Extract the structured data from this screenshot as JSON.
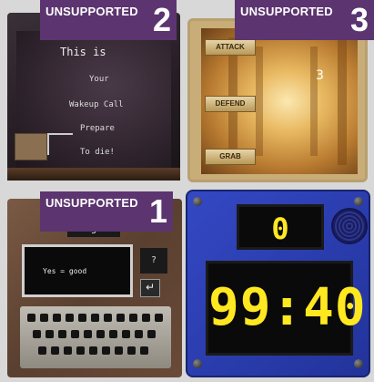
{
  "panels": [
    {
      "tag": "UNSUPPORTED",
      "number": "2"
    },
    {
      "tag": "UNSUPPORTED",
      "number": "3"
    },
    {
      "tag": "UNSUPPORTED",
      "number": "1"
    }
  ],
  "puzzle2": {
    "lines": [
      "This is",
      "Your",
      "Wakeup Call",
      "Prepare",
      "To die!"
    ]
  },
  "puzzle3": {
    "buttons": [
      "ATTACK",
      "DEFEND",
      "GRAB"
    ],
    "value": "3"
  },
  "puzzle1": {
    "begin_label": "Begin",
    "screen_text": "Yes = good",
    "question_mark": "?",
    "enter_icon": "enter-icon"
  },
  "timer": {
    "counter": "0",
    "clock": "99:40"
  },
  "colors": {
    "tag_purple": "#5c3470",
    "digit_yellow": "#ffe820",
    "timer_blue": "#2a3fb0"
  }
}
